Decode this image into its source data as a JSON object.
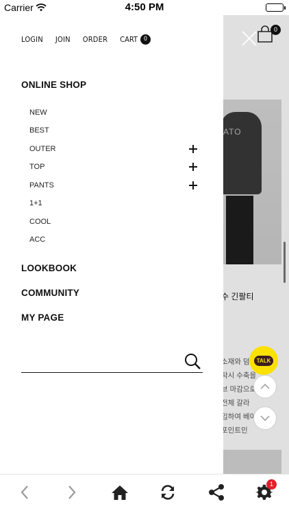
{
  "status_bar": {
    "carrier": "Carrier",
    "time": "4:50 PM"
  },
  "drawer": {
    "top_links": [
      "LOGIN",
      "JOIN",
      "ORDER"
    ],
    "cart_label": "CART",
    "cart_count": "0",
    "online_shop": "ONLINE SHOP",
    "categories": [
      {
        "label": "NEW",
        "expandable": false
      },
      {
        "label": "BEST",
        "expandable": false
      },
      {
        "label": "OUTER",
        "expandable": true
      },
      {
        "label": "TOP",
        "expandable": true
      },
      {
        "label": "PANTS",
        "expandable": true
      },
      {
        "label": "1+1",
        "expandable": false
      },
      {
        "label": "COOL",
        "expandable": false
      },
      {
        "label": "ACC",
        "expandable": false
      }
    ],
    "lookbook": "LOOKBOOK",
    "community": "COMMUNITY",
    "my_page": "MY PAGE",
    "search_placeholder": ""
  },
  "background": {
    "cart_badge": "0",
    "product_title": "수 긴팔티",
    "product_desc_lines": [
      "소재와 덤",
      "탁시 수축을",
      "브 마감으로 F",
      "전체 갈라",
      "입하여 베이",
      "포인트인"
    ],
    "photo_print": "ATO"
  },
  "kakao": {
    "label": "TALK",
    "color": "#fae100"
  },
  "toolbar": {
    "settings_badge": "1",
    "icons": [
      "back-icon",
      "forward-icon",
      "home-icon",
      "refresh-icon",
      "share-icon",
      "settings-icon"
    ]
  }
}
